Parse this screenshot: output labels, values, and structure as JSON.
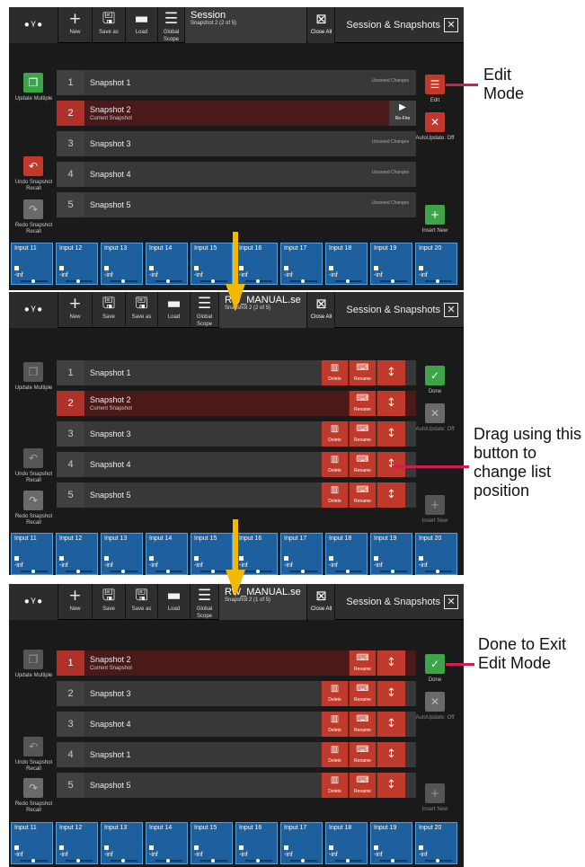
{
  "toolbar": {
    "new_label": "New",
    "save_as_label": "Save as",
    "save_label": "Save",
    "load_label": "Load",
    "global_scope_label": "Global Scope",
    "close_all_label": "Close All"
  },
  "panels": [
    {
      "session_title": "Session",
      "session_sub": "Snapshot 2 (2 of 5)",
      "session_status": "",
      "panel_title": "Session & Snapshots",
      "rows": [
        {
          "num": "1",
          "name": "Snapshot 1",
          "sub": "",
          "status": "Unsaved Changes"
        },
        {
          "num": "2",
          "name": "Snapshot 2",
          "sub": "Current Snapshot",
          "status": "Re-Fire"
        },
        {
          "num": "3",
          "name": "Snapshot 3",
          "sub": "",
          "status": "Unsaved Changes"
        },
        {
          "num": "4",
          "name": "Snapshot 4",
          "sub": "",
          "status": "Unsaved Changes"
        },
        {
          "num": "5",
          "name": "Snapshot 5",
          "sub": "",
          "status": "Unsaved Changes"
        }
      ],
      "right_buttons": {
        "edit": "Edit",
        "autoupdate": "AutoUpdate: Off",
        "insert": "Insert New"
      }
    },
    {
      "session_title": "RW_MANUAL.ses...",
      "session_sub": "Snapshot 2 (2 of 5)",
      "session_status": "",
      "panel_title": "Session & Snapshots",
      "rows": [
        {
          "num": "1",
          "name": "Snapshot 1",
          "sub": ""
        },
        {
          "num": "2",
          "name": "Snapshot 2",
          "sub": "Current Snapshot"
        },
        {
          "num": "3",
          "name": "Snapshot 3",
          "sub": ""
        },
        {
          "num": "4",
          "name": "Snapshot 4",
          "sub": ""
        },
        {
          "num": "5",
          "name": "Snapshot 5",
          "sub": ""
        }
      ],
      "right_buttons": {
        "done": "Done",
        "autoupdate": "AutoUpdate: Off",
        "insert": "Insert New"
      }
    },
    {
      "session_title": "RW_MANUAL.ses...",
      "session_sub": "Snapshot 2 (1 of 5)",
      "session_status": "",
      "panel_title": "Session & Snapshots",
      "rows": [
        {
          "num": "1",
          "name": "Snapshot 2",
          "sub": "Current Snapshot"
        },
        {
          "num": "2",
          "name": "Snapshot 3",
          "sub": ""
        },
        {
          "num": "3",
          "name": "Snapshot 4",
          "sub": ""
        },
        {
          "num": "4",
          "name": "Snapshot 1",
          "sub": ""
        },
        {
          "num": "5",
          "name": "Snapshot 5",
          "sub": ""
        }
      ],
      "right_buttons": {
        "done": "Done",
        "autoupdate": "AutoUpdate: Off",
        "insert": "Insert New"
      }
    }
  ],
  "row_actions": {
    "delete": "Delete",
    "rename": "Rename"
  },
  "left_buttons": {
    "update_multiple": "Update Multiple",
    "undo": "Undo Snapshot Recall",
    "redo": "Redo Snapshot Recall"
  },
  "inputs": [
    {
      "name": "Input 11",
      "value": "-inf"
    },
    {
      "name": "Input 12",
      "value": "-inf"
    },
    {
      "name": "Input 13",
      "value": "-inf"
    },
    {
      "name": "Input 14",
      "value": "-inf"
    },
    {
      "name": "Input 15",
      "value": "-inf"
    },
    {
      "name": "Input 16",
      "value": "-inf"
    },
    {
      "name": "Input 17",
      "value": "-inf"
    },
    {
      "name": "Input 18",
      "value": "-inf"
    },
    {
      "name": "Input 19",
      "value": "-inf"
    },
    {
      "name": "Input 20",
      "value": "-inf"
    }
  ],
  "annotations": {
    "edit_mode": "Edit Mode",
    "drag": "Drag using this button to change list position",
    "done": "Done to Exit Edit Mode"
  },
  "colors": {
    "accent_red": "#c0392b",
    "done_green": "#3ea34a",
    "input_blue": "#1e5f9e",
    "callout": "#d11e4f",
    "arrow": "#f5b800"
  }
}
